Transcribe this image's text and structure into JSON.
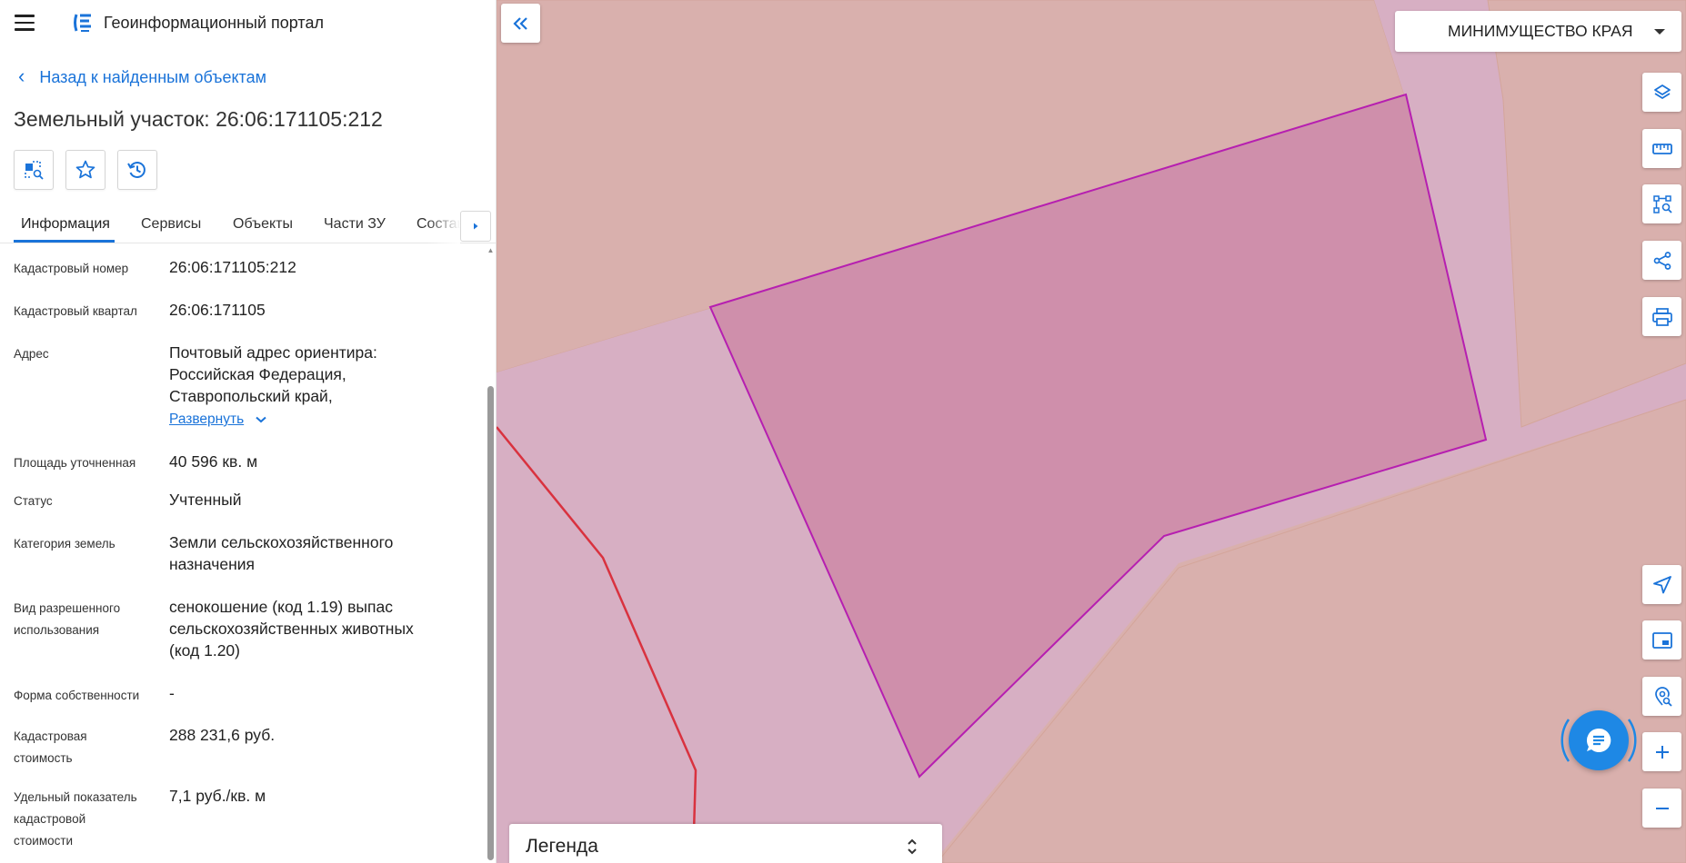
{
  "app": {
    "title": "Геоинформационный портал"
  },
  "panel": {
    "back_label": "Назад к найденным объектам",
    "object_title": "Земельный участок: 26:06:171105:212",
    "actions": [
      {
        "icon": "zoom-to-object-icon"
      },
      {
        "icon": "star-icon"
      },
      {
        "icon": "history-icon"
      }
    ],
    "tabs": [
      {
        "label": "Информация",
        "active": true
      },
      {
        "label": "Сервисы"
      },
      {
        "label": "Объекты"
      },
      {
        "label": "Части ЗУ"
      },
      {
        "label": "Состав"
      }
    ],
    "info": {
      "cad_number": {
        "label": "Кадастровый номер",
        "value": "26:06:171105:212"
      },
      "cad_block": {
        "label": "Кадастровый квартал",
        "value": "26:06:171105"
      },
      "address": {
        "label": "Адрес",
        "value_lines": [
          "Почтовый адрес ориентира:",
          "Российская Федерация,",
          "Ставропольский край,"
        ],
        "expand_label": "Развернуть"
      },
      "area": {
        "label": "Площадь уточненная",
        "value": "40 596 кв. м"
      },
      "status": {
        "label": "Статус",
        "value": "Учтенный"
      },
      "category": {
        "label": "Категория земель",
        "value_lines": [
          "Земли сельскохозяйственного",
          "назначения"
        ]
      },
      "permitted_use": {
        "label_lines": [
          "Вид разрешенного",
          "использования"
        ],
        "value_lines": [
          "сенокошение (код 1.19) выпас",
          "сельскохозяйственных животных",
          "(код 1.20)"
        ]
      },
      "ownership": {
        "label": "Форма собственности",
        "value": "-"
      },
      "cad_value": {
        "label_lines": [
          "Кадастровая",
          "стоимость"
        ],
        "value": "288 231,6 руб."
      },
      "specific_value": {
        "label_lines": [
          "Удельный показатель",
          "кадастровой",
          "стоимости"
        ],
        "value": "7,1 руб./кв. м"
      }
    }
  },
  "map": {
    "org_selector": "МИНИМУЩЕСТВО КРАЯ",
    "legend_label": "Легенда",
    "tools": [
      "layers-icon",
      "ruler-icon",
      "select-area-icon",
      "share-icon",
      "print-icon",
      "locate-icon",
      "minimap-icon",
      "geo-search-icon",
      "zoom-in-icon",
      "zoom-out-icon"
    ],
    "colors": {
      "accent": "#1a73d9",
      "parcel_stroke": "#b61fb0",
      "boundary": "#d9323f"
    }
  }
}
